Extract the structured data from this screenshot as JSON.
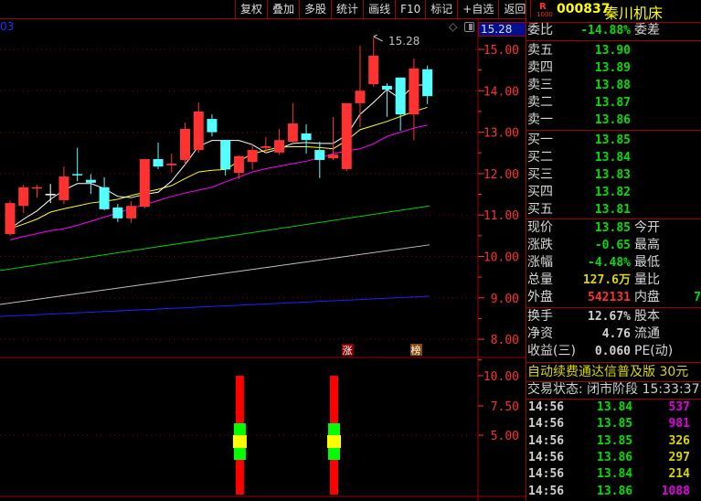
{
  "toolbar": {
    "items": [
      "复权",
      "叠加",
      "多股",
      "统计",
      "画线",
      "F10",
      "标记",
      "+自选",
      "返回"
    ]
  },
  "stock": {
    "badge_r": "R",
    "badge_num": "1000",
    "code": "000837",
    "name": "秦川机床"
  },
  "chart": {
    "period_label": "03",
    "high_label": "15.28",
    "cursor_price": "15.28",
    "diamond_icon": "diamond-icon",
    "toggle_icon": "panel-toggle-icon",
    "price_axis": [
      "15.00",
      "14.00",
      "13.00",
      "12.00",
      "11.00",
      "10.00",
      "9.00",
      "8.00"
    ],
    "indicator_axis": [
      "10.00",
      "7.50",
      "5.00"
    ],
    "markers": [
      "涨",
      "榜"
    ]
  },
  "chart_data": {
    "type": "candlestick",
    "ylim": [
      7.6,
      15.6
    ],
    "candles": [
      [
        10.54,
        11.29,
        11.35,
        10.5
      ],
      [
        11.22,
        11.67,
        11.73,
        11.05
      ],
      [
        11.65,
        11.67,
        11.73,
        11.42
      ],
      [
        11.51,
        11.51,
        11.75,
        11.29
      ],
      [
        11.36,
        11.93,
        12.17,
        11.27
      ],
      [
        11.99,
        11.99,
        12.62,
        11.82
      ],
      [
        11.85,
        11.78,
        11.99,
        11.51
      ],
      [
        11.67,
        11.14,
        11.91,
        11.11
      ],
      [
        11.18,
        10.92,
        11.27,
        10.83
      ],
      [
        10.92,
        11.22,
        11.33,
        10.81
      ],
      [
        11.2,
        12.35,
        12.35,
        11.16
      ],
      [
        12.35,
        12.17,
        12.75,
        12.11
      ],
      [
        12.2,
        12.24,
        12.48,
        12.02
      ],
      [
        12.33,
        13.08,
        13.23,
        12.22
      ],
      [
        12.57,
        13.5,
        13.72,
        12.5
      ],
      [
        13.32,
        13.0,
        13.43,
        12.9
      ],
      [
        12.81,
        12.1,
        12.81,
        11.95
      ],
      [
        12.02,
        12.42,
        12.44,
        11.87
      ],
      [
        12.28,
        12.57,
        12.7,
        12.1
      ],
      [
        12.62,
        12.66,
        12.88,
        12.5
      ],
      [
        12.51,
        12.81,
        13.08,
        12.46
      ],
      [
        12.77,
        13.21,
        13.7,
        12.73
      ],
      [
        12.97,
        12.81,
        13.19,
        12.48
      ],
      [
        12.57,
        12.33,
        12.77,
        11.89
      ],
      [
        12.37,
        12.46,
        13.37,
        12.33
      ],
      [
        12.11,
        13.7,
        13.7,
        12.06
      ],
      [
        13.7,
        14.0,
        15.09,
        13.12
      ],
      [
        14.16,
        14.85,
        15.28,
        14.1
      ],
      [
        14.12,
        14.03,
        14.18,
        13.37
      ],
      [
        14.32,
        13.43,
        14.32,
        13.03
      ],
      [
        13.43,
        14.54,
        14.78,
        12.81
      ],
      [
        14.52,
        13.87,
        14.61,
        13.68
      ]
    ],
    "ma5": [
      10.67,
      10.9,
      11.1,
      11.38,
      11.6,
      11.76,
      11.76,
      11.64,
      11.45,
      11.42,
      11.5,
      11.55,
      11.82,
      12.22,
      12.66,
      12.8,
      12.8,
      12.8,
      12.7,
      12.5,
      12.6,
      12.73,
      12.75,
      12.73,
      12.73,
      12.93,
      13.43,
      13.72,
      14.03,
      13.8,
      14.14,
      14.14
    ],
    "ma10": [
      10.67,
      10.78,
      10.9,
      11.07,
      11.15,
      11.22,
      11.29,
      11.33,
      11.38,
      11.47,
      11.55,
      11.62,
      11.71,
      11.88,
      12.04,
      12.08,
      12.1,
      12.3,
      12.48,
      12.56,
      12.64,
      12.65,
      12.65,
      12.63,
      12.6,
      12.8,
      13.06,
      13.16,
      13.26,
      13.38,
      13.5,
      13.6
    ],
    "ma20": [
      10.4,
      10.48,
      10.55,
      10.62,
      10.67,
      10.75,
      10.85,
      10.95,
      11.05,
      11.16,
      11.25,
      11.35,
      11.45,
      11.53,
      11.6,
      11.67,
      11.8,
      11.92,
      12.04,
      12.12,
      12.18,
      12.24,
      12.3,
      12.38,
      12.48,
      12.55,
      12.6,
      12.72,
      12.9,
      13.0,
      13.1,
      13.17
    ],
    "ma_long": [
      {
        "name": "green",
        "from": 9.66,
        "to": 11.22,
        "color": "#00d000"
      },
      {
        "name": "gray",
        "from": 8.84,
        "to": 10.28,
        "color": "#c0c0c0"
      },
      {
        "name": "blue",
        "from": 8.55,
        "to": 9.04,
        "color": "#2020ff"
      }
    ],
    "indicator": {
      "bars_at": [
        17,
        24
      ],
      "red_range": [
        0,
        10
      ],
      "green_range": [
        3.4,
        7.0
      ],
      "yellow_range": [
        4.4,
        5.6
      ]
    }
  },
  "quote": {
    "weibi_label": "委比",
    "weibi": "-14.88%",
    "weicha_label": "委差",
    "asks": [
      {
        "label": "卖五",
        "price": "13.90"
      },
      {
        "label": "卖四",
        "price": "13.89"
      },
      {
        "label": "卖三",
        "price": "13.88"
      },
      {
        "label": "卖二",
        "price": "13.87"
      },
      {
        "label": "卖一",
        "price": "13.86"
      }
    ],
    "bids": [
      {
        "label": "买一",
        "price": "13.85"
      },
      {
        "label": "买二",
        "price": "13.84"
      },
      {
        "label": "买三",
        "price": "13.83"
      },
      {
        "label": "买四",
        "price": "13.82"
      },
      {
        "label": "买五",
        "price": "13.81"
      }
    ],
    "stats": [
      {
        "l": "现价",
        "v": "13.85",
        "l2": "今开"
      },
      {
        "l": "涨跌",
        "v": "-0.65",
        "l2": "最高"
      },
      {
        "l": "涨幅",
        "v": "-4.48%",
        "l2": "最低"
      },
      {
        "l": "总量",
        "v": "127.6万",
        "l2": "量比"
      },
      {
        "l": "外盘",
        "v": "542131",
        "l2": "内盘",
        "v2": "7"
      }
    ],
    "fin": [
      {
        "l": "换手",
        "v": "12.67%",
        "l2": "股本"
      },
      {
        "l": "净资",
        "v": "4.76",
        "l2": "流通"
      },
      {
        "l": "收益(三)",
        "v": "0.060",
        "l2": "PE(动)"
      }
    ],
    "promo": "自动续费通达信普及版  30元",
    "status": "交易状态: 闭市阶段 15:33:37"
  },
  "ticks": [
    {
      "t": "14:56",
      "p": "13.84",
      "v": "537",
      "c": "m"
    },
    {
      "t": "14:56",
      "p": "13.85",
      "v": "981",
      "c": "m"
    },
    {
      "t": "14:56",
      "p": "13.85",
      "v": "326",
      "c": "y"
    },
    {
      "t": "14:56",
      "p": "13.86",
      "v": "297",
      "c": "y"
    },
    {
      "t": "14:56",
      "p": "13.84",
      "v": "214",
      "c": "y"
    },
    {
      "t": "14:56",
      "p": "13.86",
      "v": "1088",
      "c": "m"
    }
  ]
}
